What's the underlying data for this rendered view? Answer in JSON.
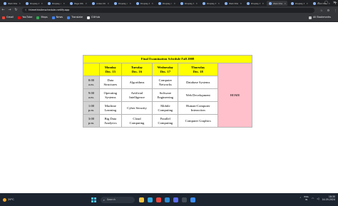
{
  "browser": {
    "tabs": [
      {
        "title": "Web title"
      },
      {
        "title": "Display title"
      },
      {
        "title": "Display demo"
      },
      {
        "title": "Page title demo"
      },
      {
        "title": "index.html"
      },
      {
        "title": "Display demo"
      },
      {
        "title": "Display title"
      },
      {
        "title": "Display demo"
      },
      {
        "title": "Display title"
      },
      {
        "title": "Display title"
      },
      {
        "title": "Web title"
      },
      {
        "title": "Display title"
      },
      {
        "title": "Web title"
      },
      {
        "title": "Display title"
      },
      {
        "title": "Web title"
      }
    ],
    "active_tab_index": 12,
    "url": "thimethistimschedule.netlify.app",
    "bookmarks": [
      {
        "label": "Gmail",
        "color": "#ea4335"
      },
      {
        "label": "YouTube",
        "color": "#ff0000"
      },
      {
        "label": "Maps",
        "color": "#34a853"
      },
      {
        "label": "News",
        "color": "#4285f4"
      },
      {
        "label": "Translate",
        "color": "#4285f4"
      },
      {
        "label": "GitHub",
        "color": "#e8eaed"
      }
    ],
    "all_bookmarks_label": "All Bookmarks"
  },
  "schedule": {
    "title": "Final Examination Schedule   Fall 2008",
    "headers": [
      {
        "day": "Monday",
        "date": "Dec. 15"
      },
      {
        "day": "Tuesday",
        "date": "Dec. 16"
      },
      {
        "day": "Wednesday",
        "date": "Dec. 17"
      },
      {
        "day": "Thursday",
        "date": "Dec. 18"
      }
    ],
    "home_label": "HOME",
    "rows": [
      {
        "time": [
          "8:00",
          "a.m."
        ],
        "courses": [
          [
            "Data",
            "Structures"
          ],
          [
            "Algorithms"
          ],
          [
            "Computer",
            "Networks"
          ],
          [
            "Database Systems"
          ]
        ]
      },
      {
        "time": [
          "9:00",
          "a.m."
        ],
        "courses": [
          [
            "Operating",
            "Systems"
          ],
          [
            "Artificial",
            "Intelligence"
          ],
          [
            "Software",
            "Engineering"
          ],
          [
            "Web Development"
          ]
        ]
      },
      {
        "time": [
          "1:00",
          "p.m."
        ],
        "courses": [
          [
            "Machine",
            "Learning"
          ],
          [
            "Cyber Security"
          ],
          [
            "Mobile",
            "Computing"
          ],
          [
            "Human-Computer",
            "Interaction"
          ]
        ]
      },
      {
        "time": [
          "3:00",
          "p.m."
        ],
        "courses": [
          [
            "Big Data",
            "Analytics"
          ],
          [
            "Cloud",
            "Computing"
          ],
          [
            "Parallel",
            "Computing"
          ],
          [
            "Computer Graphics"
          ]
        ]
      }
    ]
  },
  "taskbar": {
    "weather_temp": "29°C",
    "search_placeholder": "Search",
    "apps": [
      {
        "name": "file-explorer",
        "color": "#f3c33f"
      },
      {
        "name": "edge",
        "color": "#2fa7e0"
      },
      {
        "name": "chrome",
        "color": "#e8453c"
      },
      {
        "name": "vscode",
        "color": "#2a8ad4"
      },
      {
        "name": "store",
        "color": "#5b6cf0"
      },
      {
        "name": "terminal",
        "color": "#444c56"
      },
      {
        "name": "mail",
        "color": "#3c8cf0"
      }
    ],
    "lang_line1": "ENG",
    "lang_line2": "IN",
    "time": "18:30",
    "date": "14-05-2024"
  },
  "colors": {
    "header_yellow": "#ffff00",
    "time_gray": "#d3d3d3",
    "home_pink": "#ffc0cb"
  }
}
